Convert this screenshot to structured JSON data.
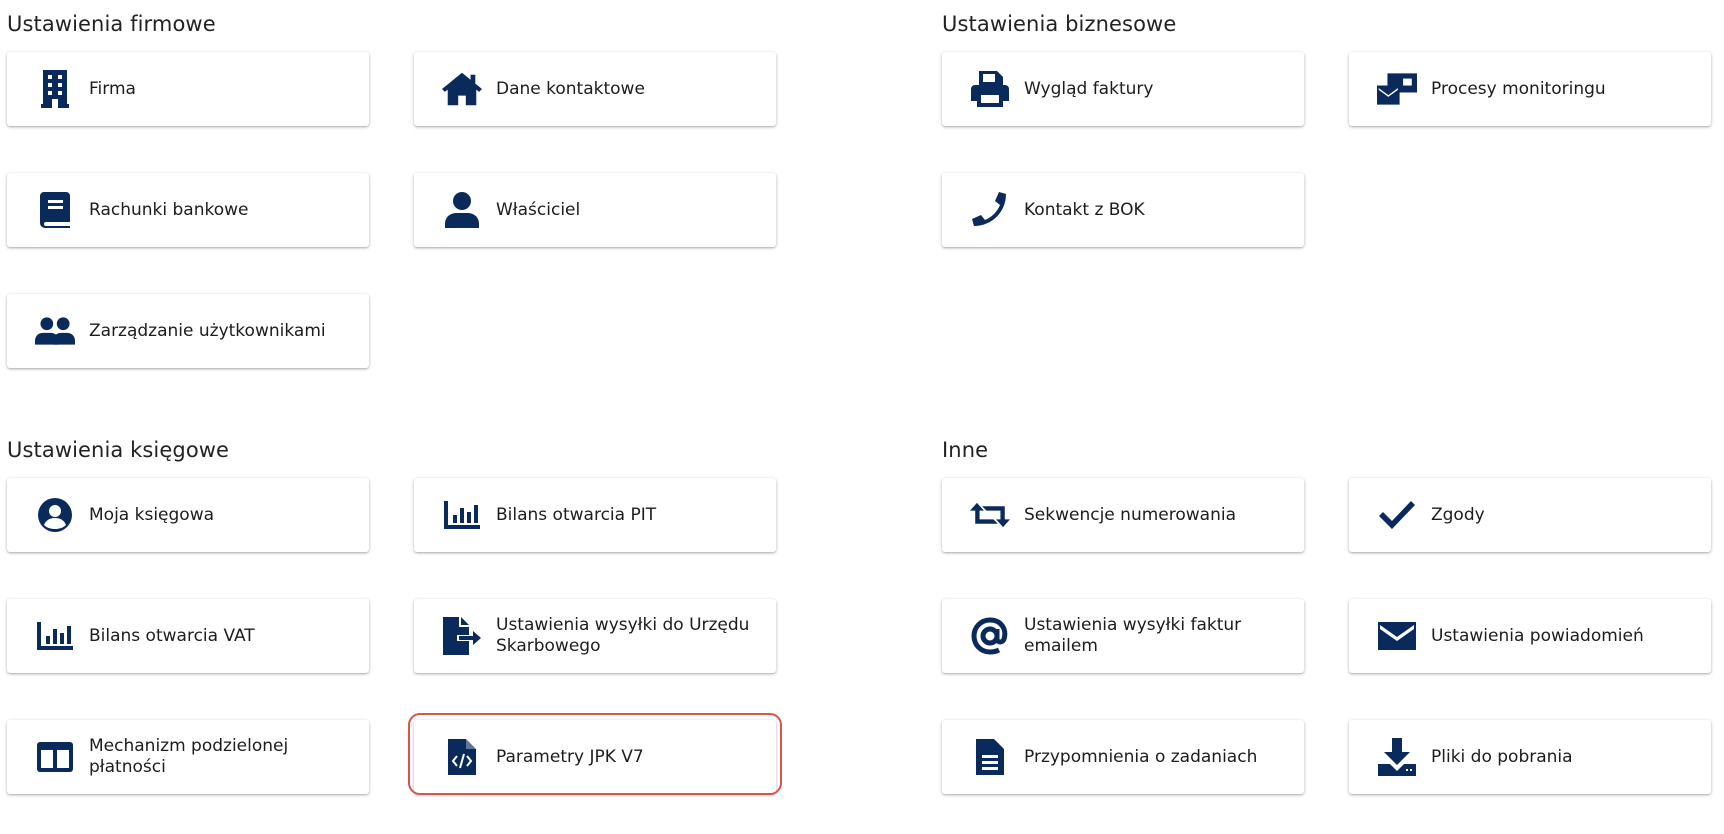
{
  "sections": {
    "firmowe": "Ustawienia firmowe",
    "biznesowe": "Ustawienia biznesowe",
    "ksiegowe": "Ustawienia księgowe",
    "inne": "Inne"
  },
  "tiles": {
    "firma": {
      "label": "Firma",
      "icon": "building-icon"
    },
    "dane_kontaktowe": {
      "label": "Dane kontaktowe",
      "icon": "home-icon"
    },
    "rachunki": {
      "label": "Rachunki bankowe",
      "icon": "book-icon"
    },
    "wlasciciel": {
      "label": "Właściciel",
      "icon": "user-icon"
    },
    "zarzadzanie": {
      "label": "Zarządzanie użytkownikami",
      "icon": "users-icon"
    },
    "wyglad": {
      "label": "Wygląd faktury",
      "icon": "printer-icon"
    },
    "procesy": {
      "label": "Procesy monitoringu",
      "icon": "mail-box-icon"
    },
    "kontakt_bok": {
      "label": "Kontakt z BOK",
      "icon": "phone-icon"
    },
    "moja_ksiegowa": {
      "label": "Moja księgowa",
      "icon": "user-circle-icon"
    },
    "bilans_pit": {
      "label": "Bilans otwarcia PIT",
      "icon": "chart-bars-icon"
    },
    "bilans_vat": {
      "label": "Bilans otwarcia VAT",
      "icon": "chart-bars-icon"
    },
    "wysylka_us": {
      "label": "Ustawienia wysyłki do Urzędu Skarbowego",
      "icon": "file-export-icon"
    },
    "mechanizm": {
      "label": "Mechanizm podzielonej płatności",
      "icon": "columns-icon"
    },
    "jpk": {
      "label": "Parametry JPK V7",
      "icon": "file-code-icon"
    },
    "sekwencje": {
      "label": "Sekwencje numerowania",
      "icon": "retweet-icon"
    },
    "zgody": {
      "label": "Zgody",
      "icon": "check-icon"
    },
    "wysylka_email": {
      "label": "Ustawienia wysyłki faktur emailem",
      "icon": "at-icon"
    },
    "powiadomienia": {
      "label": "Ustawienia powiadomień",
      "icon": "envelope-icon"
    },
    "przypomnienia": {
      "label": "Przypomnienia o zadaniach",
      "icon": "file-text-icon"
    },
    "pliki": {
      "label": "Pliki do pobrania",
      "icon": "download-icon"
    }
  },
  "colors": {
    "icon": "#0b2a5c",
    "highlight": "#d9534f"
  }
}
